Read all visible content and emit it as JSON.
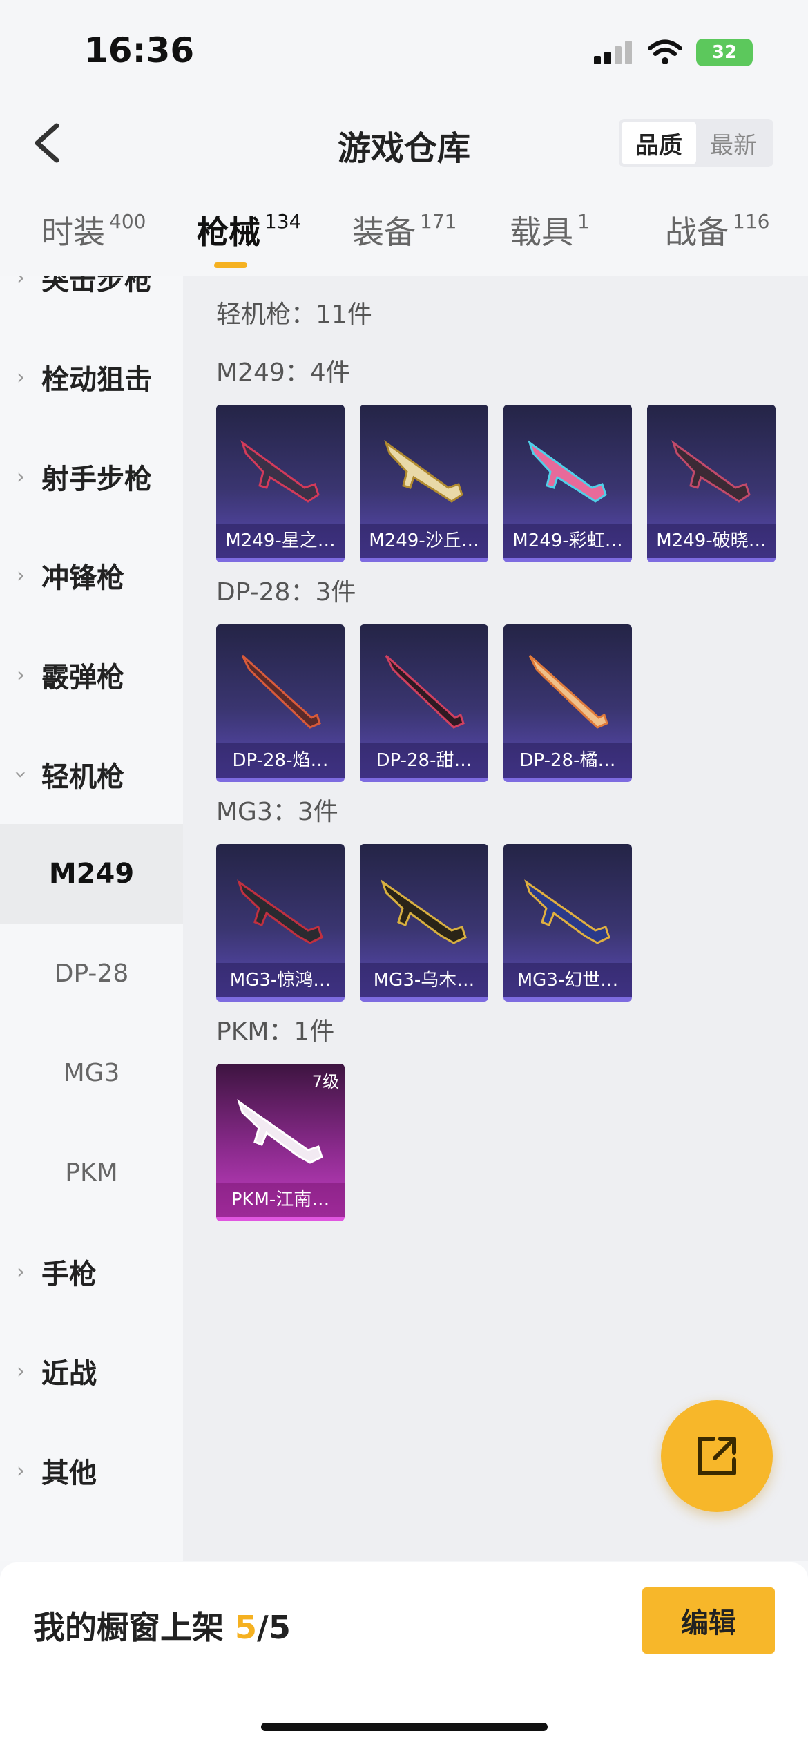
{
  "status": {
    "time": "16:36",
    "battery": "32"
  },
  "header": {
    "title": "游戏仓库",
    "sort_quality": "品质",
    "sort_newest": "最新"
  },
  "tabs": [
    {
      "label": "时装",
      "count": "400"
    },
    {
      "label": "枪械",
      "count": "134"
    },
    {
      "label": "装备",
      "count": "171"
    },
    {
      "label": "载具",
      "count": "1"
    },
    {
      "label": "战备",
      "count": "116"
    }
  ],
  "sidebar": {
    "categories": [
      {
        "label": "突击步枪"
      },
      {
        "label": "栓动狙击"
      },
      {
        "label": "射手步枪"
      },
      {
        "label": "冲锋枪"
      },
      {
        "label": "霰弹枪"
      },
      {
        "label": "轻机枪"
      },
      {
        "label": "手枪"
      },
      {
        "label": "近战"
      },
      {
        "label": "其他"
      }
    ],
    "subitems": [
      {
        "label": "M249"
      },
      {
        "label": "DP-28"
      },
      {
        "label": "MG3"
      },
      {
        "label": "PKM"
      }
    ]
  },
  "content": {
    "category_title": "轻机枪：11件",
    "groups": [
      {
        "title": "M249：4件",
        "items": [
          {
            "name": "M249-星之…"
          },
          {
            "name": "M249-沙丘…"
          },
          {
            "name": "M249-彩虹…"
          },
          {
            "name": "M249-破晓…"
          }
        ]
      },
      {
        "title": "DP-28：3件",
        "items": [
          {
            "name": "DP-28-焰…"
          },
          {
            "name": "DP-28-甜…"
          },
          {
            "name": "DP-28-橘…"
          }
        ]
      },
      {
        "title": "MG3：3件",
        "items": [
          {
            "name": "MG3-惊鸿…"
          },
          {
            "name": "MG3-乌木…"
          },
          {
            "name": "MG3-幻世…"
          }
        ]
      },
      {
        "title": "PKM：1件",
        "items": [
          {
            "name": "PKM-江南…",
            "level": "7级"
          }
        ]
      }
    ]
  },
  "bottom": {
    "showcase_label": "我的橱窗上架",
    "showcase_current": "5",
    "showcase_total": "/5",
    "edit_label": "编辑"
  },
  "colors": {
    "accent": "#f5b121",
    "purple_card": "#5b4bb5",
    "pink_card": "#c33fc3"
  }
}
